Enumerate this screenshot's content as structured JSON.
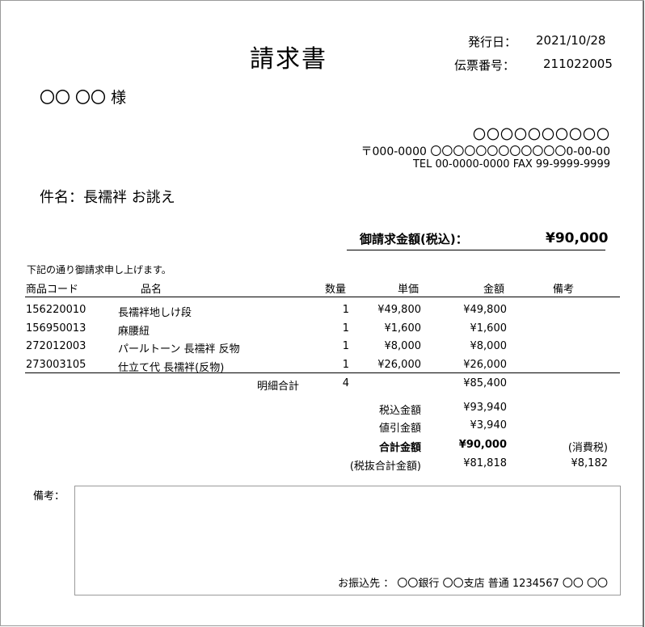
{
  "invoice": {
    "title": "請求書",
    "issue_date_label": "発行日：",
    "issue_date": "2021/10/28",
    "slip_no_label": "伝票番号：",
    "slip_no": "211022005",
    "recipient": "〇〇 〇〇 様",
    "sender": {
      "name": "〇〇〇〇〇〇〇〇〇〇",
      "address": "〒000-0000 〇〇〇〇〇〇〇〇〇〇〇〇0-00-00",
      "contact": "TEL 00-0000-0000 FAX 99-9999-9999"
    },
    "subject": "件名：長襦袢 お誂え",
    "total_label": "御請求金額(税込)：",
    "total_amount": "¥90,000",
    "intro_note": "下記の通り御請求申し上げます。"
  },
  "table": {
    "headers": [
      "商品コード",
      "品名",
      "数量",
      "単価",
      "金額",
      "備考"
    ],
    "rows": [
      {
        "code": "156220010",
        "name": "長襦袢地しけ段",
        "qty": "1",
        "unit_price": "¥49,800",
        "amount": "¥49,800",
        "remark": ""
      },
      {
        "code": "156950013",
        "name": "麻腰紐",
        "qty": "1",
        "unit_price": "¥1,600",
        "amount": "¥1,600",
        "remark": ""
      },
      {
        "code": "272012003",
        "name": "パールトーン 長襦袢 反物",
        "qty": "1",
        "unit_price": "¥8,000",
        "amount": "¥8,000",
        "remark": ""
      },
      {
        "code": "273003105",
        "name": "仕立て代 長襦袢(反物)",
        "qty": "1",
        "unit_price": "¥26,000",
        "amount": "¥26,000",
        "remark": ""
      }
    ],
    "subtotal_label": "明細合計",
    "subtotal_qty": "4",
    "subtotal_amount": "¥85,400"
  },
  "summary": {
    "tax_incl_label": "税込金額",
    "tax_incl": "¥93,940",
    "discount_label": "値引金額",
    "discount": "¥3,940",
    "grand_total_label": "合計金額",
    "grand_total": "¥90,000",
    "consumption_tax_label": "(消費税)",
    "tax_excl_label": "(税抜合計金額)",
    "tax_excl": "¥81,818",
    "consumption_tax": "¥8,182"
  },
  "remarks": {
    "label": "備考：",
    "bank": "お振込先 ： 〇〇銀行 〇〇支店 普通 1234567 〇〇 〇〇"
  }
}
